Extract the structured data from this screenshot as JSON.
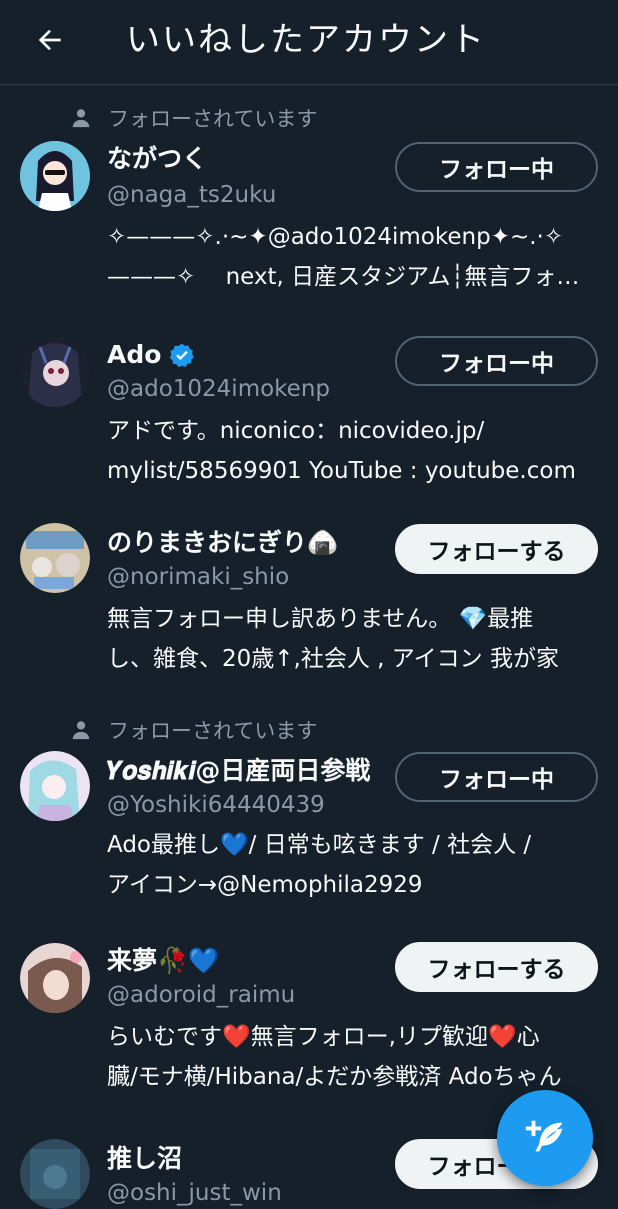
{
  "header": {
    "title": "いいねしたアカウント"
  },
  "followed_label": "フォローされています",
  "users": [
    {
      "name": "ながつく",
      "handle": "@naga_ts2uku",
      "bio_lines": [
        "✧———✧.·~✦@ado1024imokenp✦~.·✧",
        "———✧　 next, 日産スタジアム┆無言フォロー"
      ],
      "button": "フォロー中",
      "followed_by": true,
      "verified": false
    },
    {
      "name": "Ado",
      "handle": "@ado1024imokenp",
      "bio_lines": [
        "アドです。niconico：nicovideo.jp/",
        "mylist/58569901 YouTube : youtube.com"
      ],
      "button": "フォロー中",
      "followed_by": false,
      "verified": true
    },
    {
      "name": "のりまきおにぎり🍙",
      "handle": "@norimaki_shio",
      "bio_lines": [
        "無言フォロー申し訳ありません。 💎最推",
        "し、雑食、20歳↑,社会人 , アイコン 我が家"
      ],
      "button": "フォローする",
      "followed_by": false,
      "verified": false
    },
    {
      "name": "𝒀𝒐𝒔𝒉𝒊𝒌𝒊@日産両日参戦",
      "handle": "@Yoshiki64440439",
      "bio_lines": [
        "Ado最推し💙/ 日常も呟きます / 社会人 /",
        "アイコン→@Nemophila2929"
      ],
      "button": "フォロー中",
      "followed_by": true,
      "verified": false
    },
    {
      "name": "来夢🥀💙",
      "handle": "@adoroid_raimu",
      "bio_lines": [
        "らいむです❤️無言フォロー,リプ歓迎❤️心",
        "臓/モナ横/Hibana/よだか参戦済 Adoちゃん"
      ],
      "button": "フォローする",
      "followed_by": false,
      "verified": false
    },
    {
      "name": "推し沼",
      "handle": "@oshi_just_win",
      "bio_lines": [],
      "button": "フォローする",
      "followed_by": false,
      "verified": false
    }
  ],
  "colors": {
    "background": "#15202b",
    "accent": "#1d9bf0",
    "secondary_text": "#8b98a5"
  },
  "icons": {
    "back": "arrow-left-icon",
    "followed": "person-icon",
    "verified": "verified-badge-icon",
    "fab": "compose-tweet-icon"
  }
}
